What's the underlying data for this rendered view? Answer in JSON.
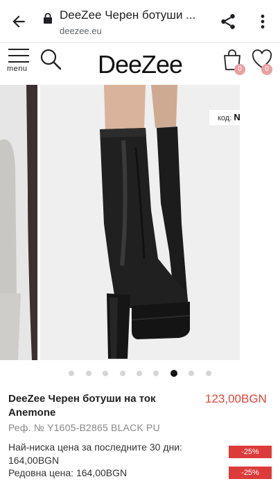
{
  "browser": {
    "title": "DeeZee Черен ботуши ...",
    "url": "deezee.eu"
  },
  "header": {
    "menu_label": "menu",
    "logo": "DeeZee",
    "cart_count": "0",
    "wishlist_count": "0"
  },
  "gallery": {
    "code_label": "код:",
    "code_value": "NIGHT",
    "total_images": 9,
    "active_index": 6
  },
  "product": {
    "name": "DeeZee Черен ботуши на ток Anemone",
    "price": "123,00BGN",
    "ref": "Реф. № Y1605-B2865 BLACK PU",
    "lowest_price_label": "Най-ниска цена за последните 30 дни: 164,00BGN",
    "discount_1": "-25%",
    "regular_price_label": "Редовна цена: 164,00BGN",
    "discount_2": "-25%"
  },
  "colors": {
    "accent_price": "#e0453a",
    "discount_badge": "#dd3b3b",
    "badge": "#e9a0a0"
  }
}
